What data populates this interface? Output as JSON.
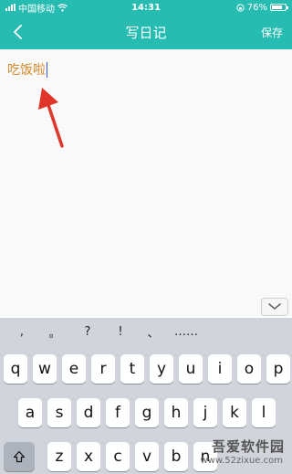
{
  "status": {
    "carrier": "中国移动",
    "time": "14:31",
    "battery_text": "76%",
    "battery_level": 0.76
  },
  "nav": {
    "title": "写日记",
    "save_label": "保存"
  },
  "editor": {
    "text": "吃饭啦"
  },
  "keyboard": {
    "punctuation": [
      ",",
      "。",
      "?",
      "!",
      "、",
      "……"
    ],
    "row1": [
      "q",
      "w",
      "e",
      "r",
      "t",
      "y",
      "u",
      "i",
      "o",
      "p"
    ],
    "row2": [
      "a",
      "s",
      "d",
      "f",
      "g",
      "h",
      "j",
      "k",
      "l"
    ],
    "row3": [
      "z",
      "x",
      "c",
      "v",
      "b",
      "n"
    ]
  },
  "watermark": {
    "brand": "吾爱软件园",
    "url": "www.52zixue.com"
  },
  "colors": {
    "accent": "#27bcb1",
    "text_orange": "#d48a2a",
    "arrow_red": "#e0352b"
  }
}
